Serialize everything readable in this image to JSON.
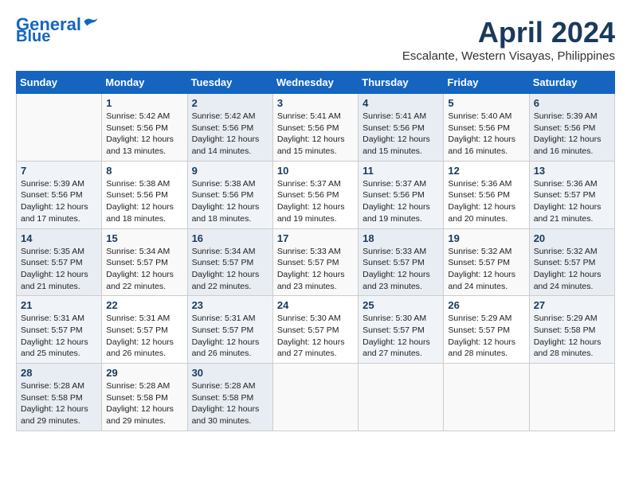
{
  "header": {
    "logo_line1": "General",
    "logo_line2": "Blue",
    "month_title": "April 2024",
    "subtitle": "Escalante, Western Visayas, Philippines"
  },
  "days_of_week": [
    "Sunday",
    "Monday",
    "Tuesday",
    "Wednesday",
    "Thursday",
    "Friday",
    "Saturday"
  ],
  "weeks": [
    [
      {
        "day": "",
        "info": ""
      },
      {
        "day": "1",
        "info": "Sunrise: 5:42 AM\nSunset: 5:56 PM\nDaylight: 12 hours\nand 13 minutes."
      },
      {
        "day": "2",
        "info": "Sunrise: 5:42 AM\nSunset: 5:56 PM\nDaylight: 12 hours\nand 14 minutes."
      },
      {
        "day": "3",
        "info": "Sunrise: 5:41 AM\nSunset: 5:56 PM\nDaylight: 12 hours\nand 15 minutes."
      },
      {
        "day": "4",
        "info": "Sunrise: 5:41 AM\nSunset: 5:56 PM\nDaylight: 12 hours\nand 15 minutes."
      },
      {
        "day": "5",
        "info": "Sunrise: 5:40 AM\nSunset: 5:56 PM\nDaylight: 12 hours\nand 16 minutes."
      },
      {
        "day": "6",
        "info": "Sunrise: 5:39 AM\nSunset: 5:56 PM\nDaylight: 12 hours\nand 16 minutes."
      }
    ],
    [
      {
        "day": "7",
        "info": "Sunrise: 5:39 AM\nSunset: 5:56 PM\nDaylight: 12 hours\nand 17 minutes."
      },
      {
        "day": "8",
        "info": "Sunrise: 5:38 AM\nSunset: 5:56 PM\nDaylight: 12 hours\nand 18 minutes."
      },
      {
        "day": "9",
        "info": "Sunrise: 5:38 AM\nSunset: 5:56 PM\nDaylight: 12 hours\nand 18 minutes."
      },
      {
        "day": "10",
        "info": "Sunrise: 5:37 AM\nSunset: 5:56 PM\nDaylight: 12 hours\nand 19 minutes."
      },
      {
        "day": "11",
        "info": "Sunrise: 5:37 AM\nSunset: 5:56 PM\nDaylight: 12 hours\nand 19 minutes."
      },
      {
        "day": "12",
        "info": "Sunrise: 5:36 AM\nSunset: 5:56 PM\nDaylight: 12 hours\nand 20 minutes."
      },
      {
        "day": "13",
        "info": "Sunrise: 5:36 AM\nSunset: 5:57 PM\nDaylight: 12 hours\nand 21 minutes."
      }
    ],
    [
      {
        "day": "14",
        "info": "Sunrise: 5:35 AM\nSunset: 5:57 PM\nDaylight: 12 hours\nand 21 minutes."
      },
      {
        "day": "15",
        "info": "Sunrise: 5:34 AM\nSunset: 5:57 PM\nDaylight: 12 hours\nand 22 minutes."
      },
      {
        "day": "16",
        "info": "Sunrise: 5:34 AM\nSunset: 5:57 PM\nDaylight: 12 hours\nand 22 minutes."
      },
      {
        "day": "17",
        "info": "Sunrise: 5:33 AM\nSunset: 5:57 PM\nDaylight: 12 hours\nand 23 minutes."
      },
      {
        "day": "18",
        "info": "Sunrise: 5:33 AM\nSunset: 5:57 PM\nDaylight: 12 hours\nand 23 minutes."
      },
      {
        "day": "19",
        "info": "Sunrise: 5:32 AM\nSunset: 5:57 PM\nDaylight: 12 hours\nand 24 minutes."
      },
      {
        "day": "20",
        "info": "Sunrise: 5:32 AM\nSunset: 5:57 PM\nDaylight: 12 hours\nand 24 minutes."
      }
    ],
    [
      {
        "day": "21",
        "info": "Sunrise: 5:31 AM\nSunset: 5:57 PM\nDaylight: 12 hours\nand 25 minutes."
      },
      {
        "day": "22",
        "info": "Sunrise: 5:31 AM\nSunset: 5:57 PM\nDaylight: 12 hours\nand 26 minutes."
      },
      {
        "day": "23",
        "info": "Sunrise: 5:31 AM\nSunset: 5:57 PM\nDaylight: 12 hours\nand 26 minutes."
      },
      {
        "day": "24",
        "info": "Sunrise: 5:30 AM\nSunset: 5:57 PM\nDaylight: 12 hours\nand 27 minutes."
      },
      {
        "day": "25",
        "info": "Sunrise: 5:30 AM\nSunset: 5:57 PM\nDaylight: 12 hours\nand 27 minutes."
      },
      {
        "day": "26",
        "info": "Sunrise: 5:29 AM\nSunset: 5:57 PM\nDaylight: 12 hours\nand 28 minutes."
      },
      {
        "day": "27",
        "info": "Sunrise: 5:29 AM\nSunset: 5:58 PM\nDaylight: 12 hours\nand 28 minutes."
      }
    ],
    [
      {
        "day": "28",
        "info": "Sunrise: 5:28 AM\nSunset: 5:58 PM\nDaylight: 12 hours\nand 29 minutes."
      },
      {
        "day": "29",
        "info": "Sunrise: 5:28 AM\nSunset: 5:58 PM\nDaylight: 12 hours\nand 29 minutes."
      },
      {
        "day": "30",
        "info": "Sunrise: 5:28 AM\nSunset: 5:58 PM\nDaylight: 12 hours\nand 30 minutes."
      },
      {
        "day": "",
        "info": ""
      },
      {
        "day": "",
        "info": ""
      },
      {
        "day": "",
        "info": ""
      },
      {
        "day": "",
        "info": ""
      }
    ]
  ]
}
